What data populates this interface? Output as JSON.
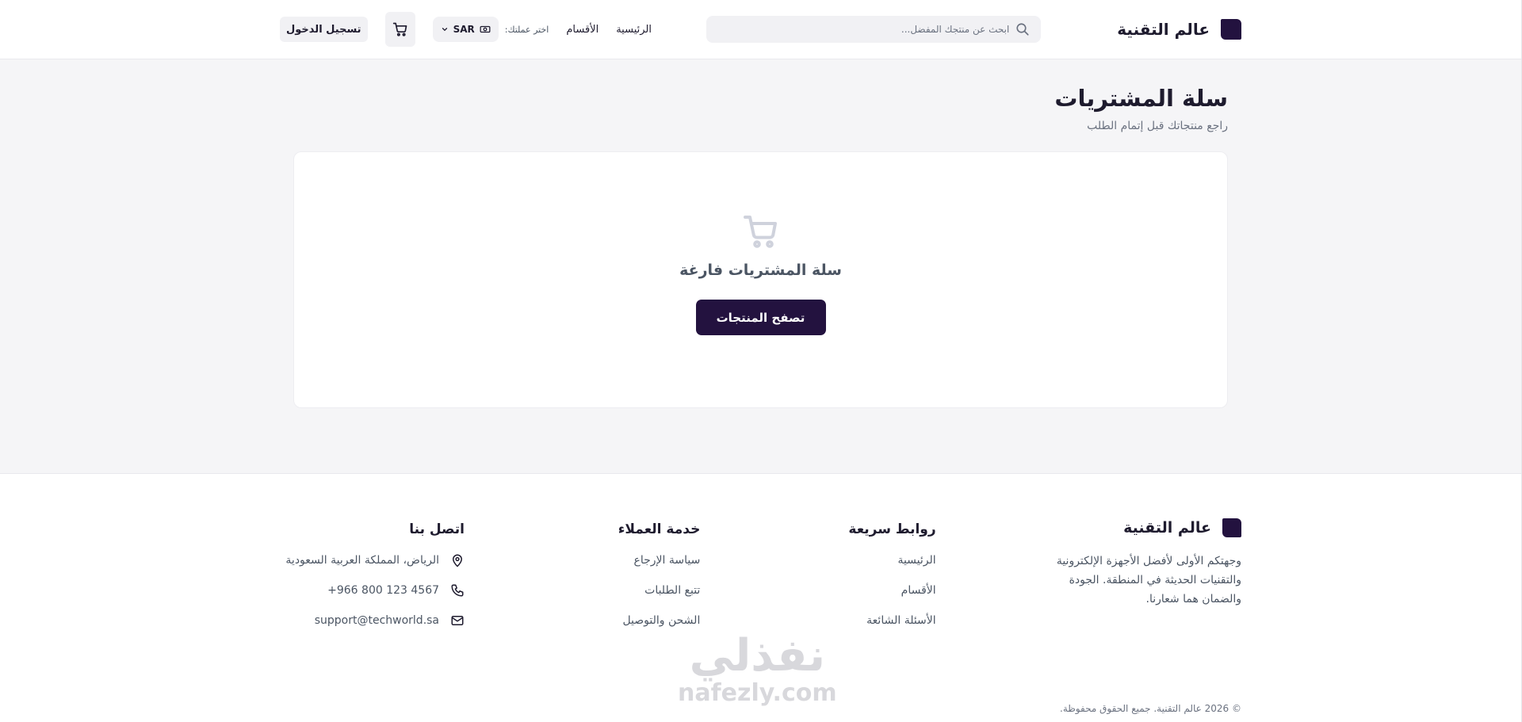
{
  "header": {
    "brand_name": "عالم التقنية",
    "search_placeholder": "ابحث عن منتجك المفضل...",
    "nav": [
      {
        "label": "الرئيسية"
      },
      {
        "label": "الأقسام"
      }
    ],
    "currency_label": "اختر عملتك:",
    "currency_value": "SAR",
    "login_label": "تسجيل الدخول"
  },
  "main": {
    "title": "سلة المشتريات",
    "subtitle": "راجع منتجاتك قبل إتمام الطلب",
    "empty_title": "سلة المشتريات فارغة",
    "browse_button": "تصفح المنتجات"
  },
  "footer": {
    "brand_name": "عالم التقنية",
    "description": "وجهتكم الأولى لأفضل الأجهزة الإلكترونية والتقنيات الحديثة في المنطقة. الجودة والضمان هما شعارنا.",
    "quick_links": {
      "heading": "روابط سريعة",
      "items": [
        "الرئيسية",
        "الأقسام",
        "الأسئلة الشائعة"
      ]
    },
    "customer_service": {
      "heading": "خدمة العملاء",
      "items": [
        "سياسة الإرجاع",
        "تتبع الطلبات",
        "الشحن والتوصيل"
      ]
    },
    "contact": {
      "heading": "اتصل بنا",
      "address": "الرياض، المملكة العربية السعودية",
      "phone": "+966 800 123 4567",
      "email": "support@techworld.sa"
    },
    "copyright": "© 2026 عالم التقنية. جميع الحقوق محفوظة."
  },
  "watermark": {
    "arabic": "نفذلي",
    "latin": "nafezly.com"
  },
  "colors": {
    "brand": "#23123f",
    "page_bg": "#f5f5f7",
    "muted_text": "#6b7280"
  }
}
